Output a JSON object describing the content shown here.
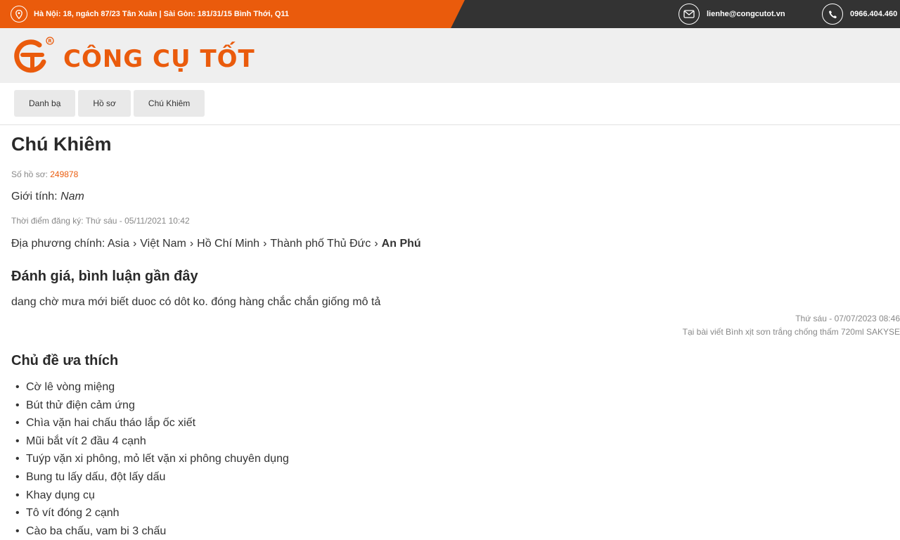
{
  "topbar": {
    "address": "Hà Nội: 18, ngách 87/23 Tân Xuân | Sài Gòn: 181/31/15 Bình Thới, Q11",
    "email": "lienhe@congcutot.vn",
    "phone": "0966.404.460",
    "icons": [
      "location-pin-icon",
      "mail-icon",
      "phone-icon"
    ],
    "colors": {
      "accent": "#ea5b0c",
      "dark": "#333333"
    }
  },
  "logo": {
    "text": "CÔNG CỤ TỐT",
    "mark": "GT",
    "registered": "®"
  },
  "breadcrumb": [
    {
      "label": "Danh bạ"
    },
    {
      "label": "Hồ sơ"
    },
    {
      "label": "Chú Khiêm"
    }
  ],
  "profile": {
    "name": "Chú Khiêm",
    "number_label": "Số hồ sơ: ",
    "number": "249878",
    "gender_label": "Giới tính: ",
    "gender": "Nam",
    "registered": "Thời điểm đăng ký: Thứ sáu - 05/11/2021 10:42",
    "location_label": "Địa phương chính: ",
    "location": [
      "Asia",
      "Việt Nam",
      "Hồ Chí Minh",
      "Thành phố Thủ Đức",
      "An Phú"
    ],
    "location_sep": "›"
  },
  "reviews": {
    "heading": "Đánh giá, bình luận gần đây",
    "items": [
      {
        "text": "dang chờ mưa mới biết duoc có dôt ko. đóng hàng chắc chắn giống mô tả",
        "date": "Thứ sáu - 07/07/2023 08:46",
        "source": "Tại bài viết Bình xịt sơn trắng chống thấm 720ml SAKYSE"
      }
    ]
  },
  "favorites": {
    "heading": "Chủ đề ưa thích",
    "bullet": "•",
    "items": [
      "Cờ lê vòng miệng",
      "Bút thử điện cảm ứng",
      "Chìa vặn hai chấu tháo lắp ốc xiết",
      "Mũi bắt vít 2 đầu 4 cạnh",
      "Tuýp vặn xi phông, mỏ lết vặn xi phông chuyên dụng",
      "Bung tu lấy dấu, đột lấy dấu",
      "Khay dụng cụ",
      "Tô vít đóng 2 cạnh",
      "Cào ba chấu, vam bi 3 chấu"
    ]
  }
}
